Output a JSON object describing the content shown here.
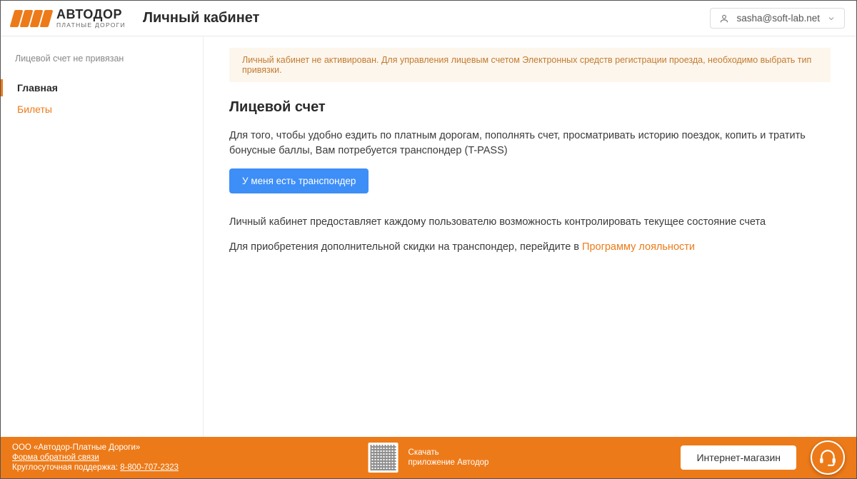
{
  "header": {
    "logo_main": "АВТОДОР",
    "logo_sub": "ПЛАТНЫЕ ДОРОГИ",
    "title": "Личный кабинет",
    "user_email": "sasha@soft-lab.net"
  },
  "sidebar": {
    "note": "Лицевой счет не привязан",
    "items": [
      {
        "label": "Главная",
        "active": true
      },
      {
        "label": "Билеты",
        "active": false
      }
    ]
  },
  "alert": {
    "text": "Личный кабинет не активирован. Для управления лицевым счетом Электронных средств регистрации проезда, необходимо выбрать тип привязки."
  },
  "page": {
    "heading": "Лицевой счет",
    "intro": "Для того, чтобы удобно ездить по платным дорогам, пополнять счет, просматривать историю поездок, копить и тратить бонусные баллы, Вам потребуется транспондер (T-PASS)",
    "have_transponder_btn": "У меня есть транспондер",
    "para2": "Личный кабинет предоставляет каждому пользователю возможность контролировать текущее состояние счета",
    "para3_prefix": "Для приобретения дополнительной скидки на транспондер, перейдите в ",
    "loyalty_link": "Программу лояльности"
  },
  "footer": {
    "company": "ООО «Автодор-Платные Дороги»",
    "feedback": "Форма обратной связи",
    "support_prefix": "Круглосуточная поддержка: ",
    "support_phone": "8-800-707-2323",
    "download_label": "Скачать",
    "app_name": "приложение Автодор",
    "store_btn": "Интернет-магазин"
  }
}
